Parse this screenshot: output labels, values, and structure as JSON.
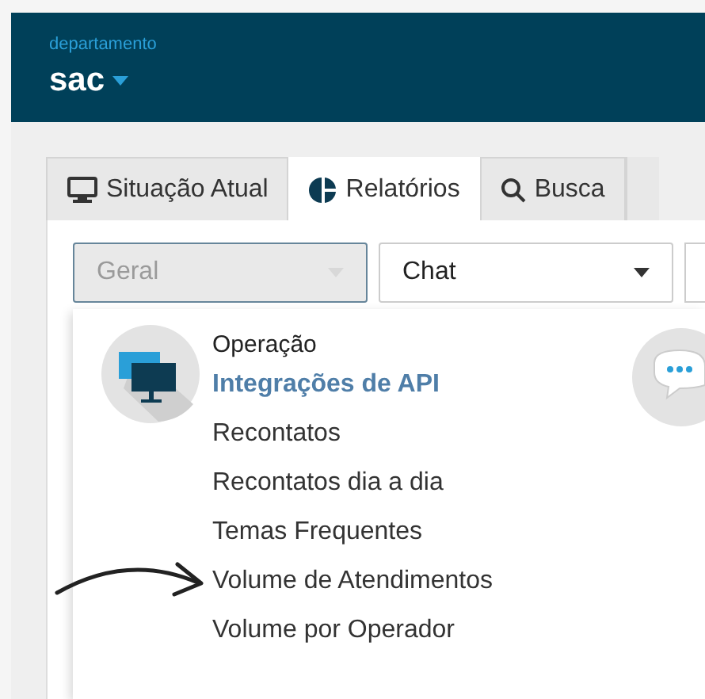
{
  "header": {
    "label": "departamento",
    "title": "sac"
  },
  "tabs": [
    {
      "label": "Situação Atual",
      "selected": false
    },
    {
      "label": "Relatórios",
      "selected": true
    },
    {
      "label": "Busca",
      "selected": false
    }
  ],
  "filters": [
    {
      "value": "Geral",
      "disabled": true
    },
    {
      "value": "Chat",
      "disabled": false
    }
  ],
  "menu": {
    "heading": "Operação",
    "items": [
      {
        "label": "Integrações de API",
        "selected": true
      },
      {
        "label": "Recontatos",
        "selected": false
      },
      {
        "label": "Recontatos dia a dia",
        "selected": false
      },
      {
        "label": "Temas Frequentes",
        "selected": false
      },
      {
        "label": "Volume de Atendimentos",
        "selected": false,
        "pointed": true
      },
      {
        "label": "Volume por Operador",
        "selected": false
      }
    ]
  }
}
